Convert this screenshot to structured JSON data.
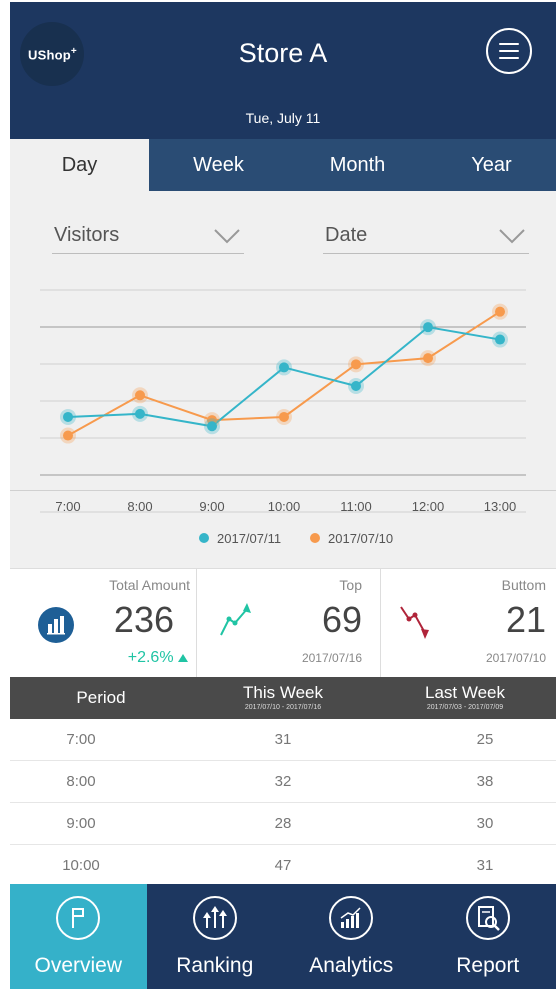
{
  "header": {
    "logo_text": "UShop",
    "logo_sup": "+",
    "title": "Store A",
    "date": "Tue, July 11"
  },
  "tabs": [
    {
      "label": "Day",
      "active": true
    },
    {
      "label": "Week",
      "active": false
    },
    {
      "label": "Month",
      "active": false
    },
    {
      "label": "Year",
      "active": false
    }
  ],
  "filters": {
    "metric": "Visitors",
    "range": "Date"
  },
  "chart_data": {
    "type": "line",
    "categories": [
      "7:00",
      "8:00",
      "9:00",
      "10:00",
      "11:00",
      "12:00",
      "13:00"
    ],
    "series": [
      {
        "name": "2017/07/11",
        "color": "#35b5c9",
        "values": [
          31,
          32,
          28,
          47,
          41,
          60,
          56
        ]
      },
      {
        "name": "2017/07/10",
        "color": "#f79a4d",
        "values": [
          25,
          38,
          30,
          31,
          48,
          50,
          65
        ]
      }
    ],
    "ylim": [
      10,
      72
    ],
    "grid": true,
    "legend": "bottom"
  },
  "cards": {
    "total": {
      "title": "Total Amount",
      "value": "236",
      "change": "+2.6%"
    },
    "top": {
      "title": "Top",
      "value": "69",
      "date": "2017/07/16"
    },
    "bottom": {
      "title": "Buttom",
      "value": "21",
      "date": "2017/07/10"
    }
  },
  "table": {
    "headers": {
      "period": "Period",
      "this_week": "This Week",
      "this_week_range": "2017/07/10 - 2017/07/16",
      "last_week": "Last Week",
      "last_week_range": "2017/07/03 - 2017/07/09"
    },
    "rows": [
      {
        "period": "7:00",
        "this_week": "31",
        "last_week": "25"
      },
      {
        "period": "8:00",
        "this_week": "32",
        "last_week": "38"
      },
      {
        "period": "9:00",
        "this_week": "28",
        "last_week": "30"
      },
      {
        "period": "10:00",
        "this_week": "47",
        "last_week": "31"
      }
    ]
  },
  "nav": [
    {
      "label": "Overview",
      "icon": "flag-icon",
      "active": true
    },
    {
      "label": "Ranking",
      "icon": "ranking-arrows-icon",
      "active": false
    },
    {
      "label": "Analytics",
      "icon": "analytics-chart-icon",
      "active": false
    },
    {
      "label": "Report",
      "icon": "report-search-icon",
      "active": false
    }
  ],
  "colors": {
    "header": "#1d3760",
    "tab_bar": "#2a4c74",
    "accent_teal": "#35b1c9",
    "series_blue": "#35b5c9",
    "series_orange": "#f79a4d",
    "change_green": "#20c4a4",
    "top_icon": "#20c4a4",
    "bottom_icon": "#b0243a"
  }
}
